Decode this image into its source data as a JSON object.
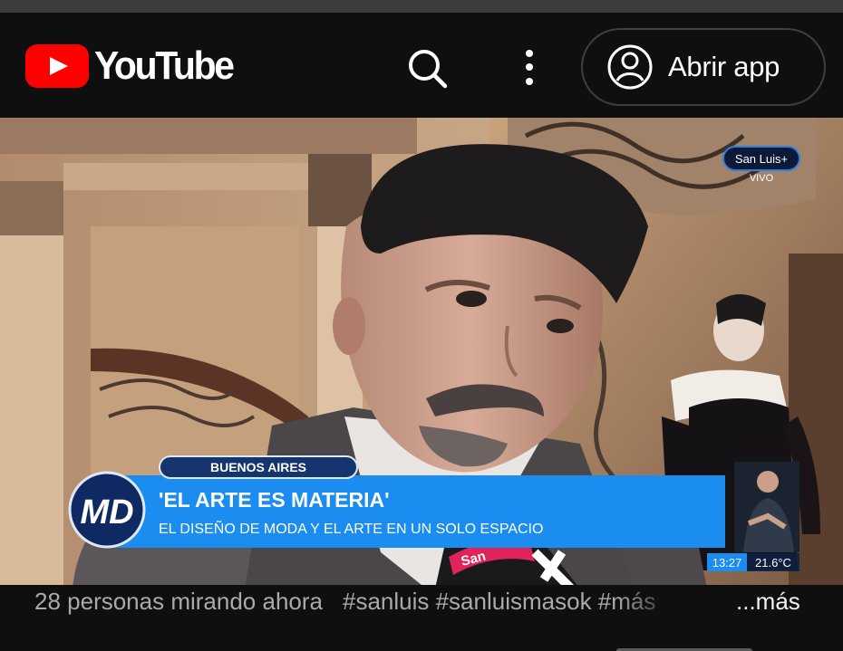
{
  "header": {
    "logo_text": "YouTube",
    "open_app_label": "Abrir app",
    "icons": [
      "youtube-logo",
      "search-icon",
      "more-vert-icon",
      "account-circle-icon"
    ]
  },
  "video": {
    "channel_bug": "San Luis+",
    "live_label": "VIVO",
    "location_tag": "BUENOS AIRES",
    "network_logo": "MD",
    "headline": "'EL ARTE ES MATERIA'",
    "subheadline": "EL DISEÑO DE MODA Y EL ARTE EN UN SOLO ESPACIO",
    "clock": "13:27",
    "temperature": "21.6°C",
    "mic_text": "San",
    "colors": {
      "banner_blue": "#1b8cf0",
      "tag_navy": "#15356f",
      "logo_navy": "#0f2a63"
    }
  },
  "info": {
    "viewers": "28 personas mirando ahora",
    "hashtags": "#sanluis #sanluismasok #más",
    "more_label": "...más"
  }
}
